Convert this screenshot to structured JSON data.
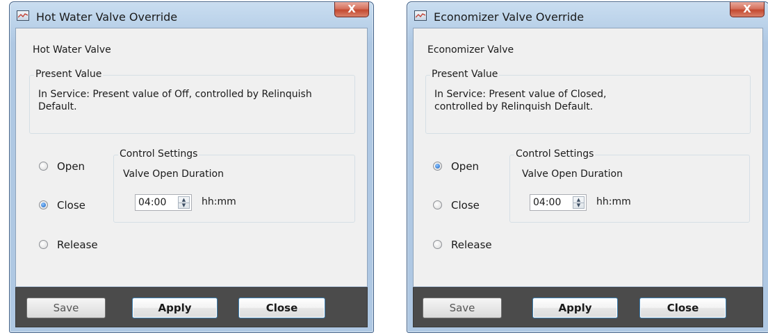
{
  "dialogs": [
    {
      "title": "Hot Water Valve Override",
      "close_symbol": "X",
      "object_name": "Hot Water Valve",
      "present_value_group": "Present Value",
      "status_text": "In Service: Present value of Off, controlled by Relinquish Default.",
      "radios": [
        {
          "label": "Open",
          "checked": false
        },
        {
          "label": "Close",
          "checked": true
        },
        {
          "label": "Release",
          "checked": false
        }
      ],
      "control_settings_group": "Control Settings",
      "duration_label": "Valve Open Duration",
      "duration_value": "04:00",
      "duration_unit": "hh:mm",
      "buttons": {
        "save": "Save",
        "apply": "Apply",
        "close": "Close"
      }
    },
    {
      "title": "Economizer Valve Override",
      "close_symbol": "X",
      "object_name": "Economizer Valve",
      "present_value_group": "Present Value",
      "status_text": "In Service: Present value of Closed, controlled by Relinquish Default.",
      "radios": [
        {
          "label": "Open",
          "checked": true
        },
        {
          "label": "Close",
          "checked": false
        },
        {
          "label": "Release",
          "checked": false
        }
      ],
      "control_settings_group": "Control Settings",
      "duration_label": "Valve Open Duration",
      "duration_value": "04:00",
      "duration_unit": "hh:mm",
      "buttons": {
        "save": "Save",
        "apply": "Apply",
        "close": "Close"
      }
    }
  ],
  "icons": {
    "app": "window-app-icon",
    "close": "close-icon",
    "spin_up": "spin-up-arrow-icon",
    "spin_down": "spin-down-arrow-icon"
  },
  "colors": {
    "title_bar": "#bcd3ea",
    "close_button": "#c44a31",
    "client_bg": "#f0f0f0",
    "footer_bg": "#4b4b4b",
    "radio_checked": "#1560c2"
  }
}
